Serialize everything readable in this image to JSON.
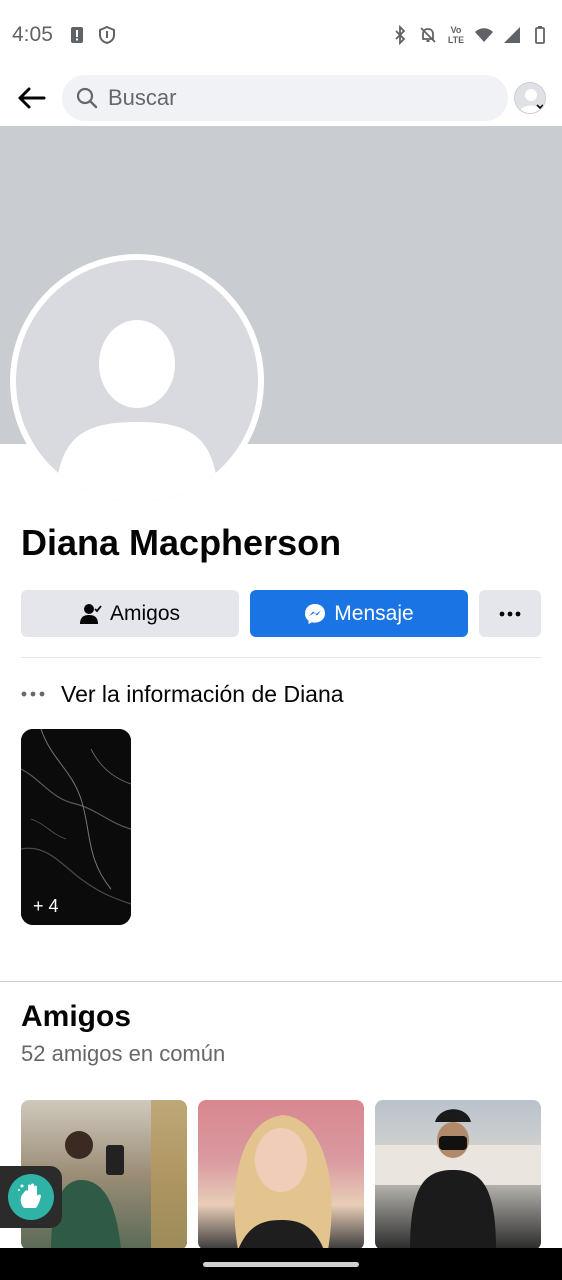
{
  "status_bar": {
    "time": "4:05",
    "icons_left": [
      "alert-icon",
      "shield-icon"
    ],
    "icons_right": [
      "bluetooth-icon",
      "bell-off-icon",
      "volte-icon",
      "wifi-icon",
      "signal-icon",
      "battery-icon"
    ],
    "volte_label": "Vo LTE"
  },
  "top_bar": {
    "back_icon": "arrow-left-icon",
    "search_placeholder": "Buscar",
    "search_icon": "search-icon",
    "account_icon": "account-avatar-icon"
  },
  "profile": {
    "name": "Diana Macpherson",
    "cover_color": "#c9ccd1"
  },
  "actions": {
    "friends_label": "Amigos",
    "message_label": "Mensaje",
    "more_icon": "more-horizontal-icon",
    "accent": "#1b74e4"
  },
  "info": {
    "label": "Ver la información de Diana"
  },
  "photos": {
    "more_count": "+ 4"
  },
  "friends_section": {
    "title": "Amigos",
    "subtitle": "52 amigos en común",
    "cards": [
      "friend-photo-1",
      "friend-photo-2",
      "friend-photo-3"
    ]
  }
}
